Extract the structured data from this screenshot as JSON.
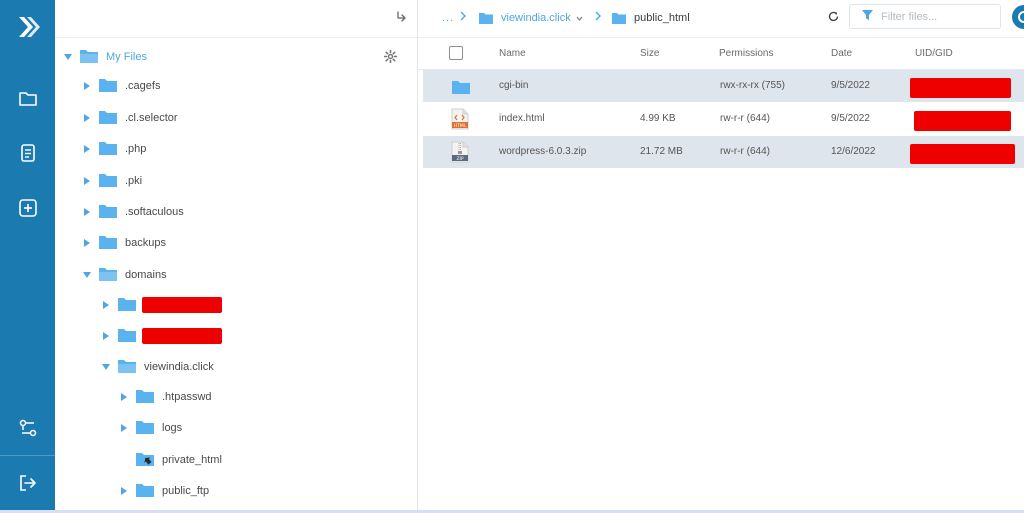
{
  "colors": {
    "rail": "#1b7bb0",
    "folder": "#5ab2ee",
    "accent": "#4fa6e0",
    "selected_row": "#dfe5ec",
    "redaction": "#ee0000"
  },
  "rail": {
    "icons": [
      "logo-icon",
      "folder-icon",
      "file-text-icon",
      "plus-square-icon",
      "connections-icon",
      "logout-icon"
    ]
  },
  "tree": {
    "jump_icon": "return-arrow-icon",
    "root": {
      "label": "My Files",
      "settings_icon": "gear-icon"
    },
    "items": [
      {
        "label": ".cagefs",
        "expanded": false
      },
      {
        "label": ".cl.selector",
        "expanded": false
      },
      {
        "label": ".php",
        "expanded": false
      },
      {
        "label": ".pki",
        "expanded": false
      },
      {
        "label": ".softaculous",
        "expanded": false
      },
      {
        "label": "backups",
        "expanded": false
      },
      {
        "label": "domains",
        "expanded": true
      },
      {
        "label": "",
        "redacted": true,
        "expanded": false
      },
      {
        "label": "",
        "redacted": true,
        "expanded": false
      },
      {
        "label": "viewindia.click",
        "expanded": true
      },
      {
        "label": ".htpasswd",
        "expanded": false
      },
      {
        "label": "logs",
        "expanded": false
      },
      {
        "label": "private_html",
        "expanded": false,
        "symlink": true
      },
      {
        "label": "public_ftp",
        "expanded": false
      }
    ]
  },
  "breadcrumb": {
    "dots": "...",
    "domain": "viewindia.click",
    "current": "public_html"
  },
  "toolbar": {
    "refresh_icon": "refresh-icon",
    "filter_placeholder": "Filter files..."
  },
  "table": {
    "columns": {
      "name": "Name",
      "size": "Size",
      "permissions": "Permissions",
      "date": "Date",
      "uid": "UID/GID"
    },
    "rows": [
      {
        "icon": "folder-icon",
        "name": "cgi-bin",
        "size": "",
        "permissions": "rwx-rx-rx (755)",
        "date": "9/5/2022",
        "uid_redacted": true,
        "selected": true
      },
      {
        "icon": "html-file-icon",
        "icon_text": "HTML",
        "name": "index.html",
        "size": "4.99 KB",
        "permissions": "rw-r-r (644)",
        "date": "9/5/2022",
        "uid_redacted": true,
        "selected": false
      },
      {
        "icon": "zip-file-icon",
        "icon_text": "ZIP",
        "name": "wordpress-6.0.3.zip",
        "size": "21.72 MB",
        "permissions": "rw-r-r (644)",
        "date": "12/6/2022",
        "uid_redacted": true,
        "selected": true
      }
    ]
  }
}
